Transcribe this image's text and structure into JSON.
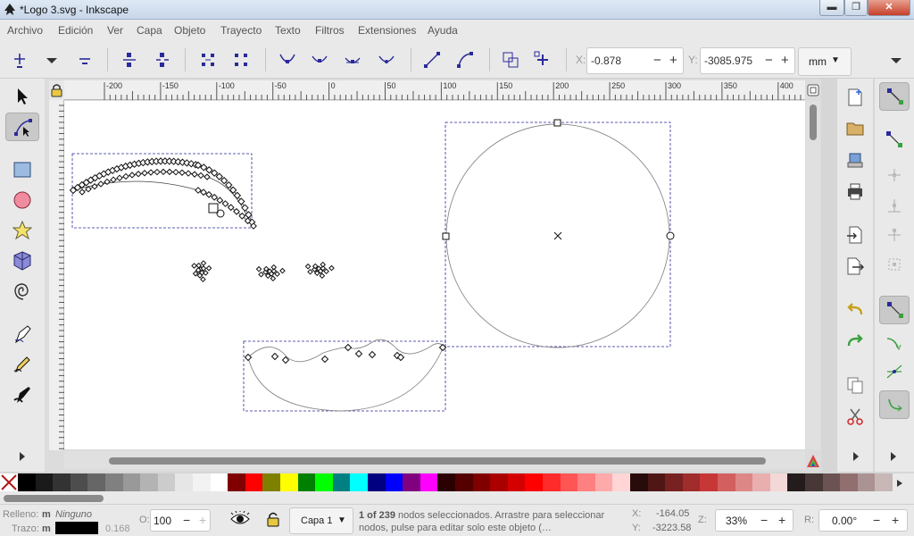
{
  "window": {
    "title": "*Logo 3.svg - Inkscape",
    "minimize": "▬",
    "maximize": "❐",
    "close": "✕"
  },
  "menu": [
    "Archivo",
    "Edición",
    "Ver",
    "Capa",
    "Objeto",
    "Trayecto",
    "Texto",
    "Filtros",
    "Extensiones",
    "Ayuda"
  ],
  "toolbar": {
    "x_label": "X:",
    "x_value": "-0.878",
    "y_label": "Y:",
    "y_value": "-3085.975",
    "unit": "mm",
    "minus": "−",
    "plus": "+",
    "dropdown": "▼"
  },
  "ruler": {
    "ticks": [
      "-200",
      "-150",
      "-100",
      "-50",
      "0",
      "50",
      "100",
      "150",
      "200",
      "250",
      "300",
      "350",
      "400"
    ]
  },
  "palette": {
    "colors": [
      "#000000",
      "#1a1a1a",
      "#333333",
      "#4d4d4d",
      "#666666",
      "#808080",
      "#999999",
      "#b3b3b3",
      "#cccccc",
      "#e6e6e6",
      "#f2f2f2",
      "#ffffff",
      "#800000",
      "#ff0000",
      "#808000",
      "#ffff00",
      "#008000",
      "#00ff00",
      "#008080",
      "#00ffff",
      "#000080",
      "#0000ff",
      "#800080",
      "#ff00ff",
      "#2b0000",
      "#550000",
      "#800000",
      "#aa0000",
      "#d40000",
      "#ff0000",
      "#ff2a2a",
      "#ff5555",
      "#ff8080",
      "#ffaaaa",
      "#ffd5d5",
      "#280b0b",
      "#501616",
      "#782121",
      "#a02c2c",
      "#c83737",
      "#d35f5f",
      "#de8787",
      "#e9afaf",
      "#f4d7d7",
      "#241c1c",
      "#483737",
      "#6c5353",
      "#916f6f",
      "#ac9393",
      "#c8b7b7"
    ]
  },
  "status": {
    "fill_label": "Relleno:",
    "fill_m": "m",
    "fill_value": "Ninguno",
    "stroke_label": "Trazo:",
    "stroke_m": "m",
    "stroke_width": "0.168",
    "opacity_label": "O:",
    "opacity_value": "100",
    "layer": "Capa 1",
    "msg_bold": "1 of 239",
    "msg_rest": " nodos seleccionados. Arrastre para seleccionar nodos, pulse para editar solo este objeto (…",
    "cursor_x_label": "X:",
    "cursor_x": "-164.05",
    "cursor_y_label": "Y:",
    "cursor_y": "-3223.58",
    "zoom_label": "Z:",
    "zoom_value": "33%",
    "rotation_label": "R:",
    "rotation_value": "0.00°"
  }
}
